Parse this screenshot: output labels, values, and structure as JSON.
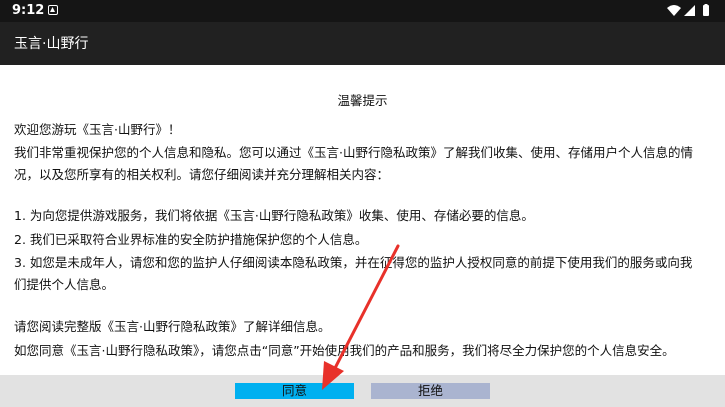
{
  "status_bar": {
    "time": "9:12",
    "icons": [
      "notification-icon",
      "wifi-icon",
      "signal-icon",
      "battery-icon"
    ]
  },
  "app_bar": {
    "title": "玉言·山野行"
  },
  "dialog": {
    "title": "温馨提示",
    "lines": [
      "欢迎您游玩《玉言·山野行》！",
      "我们非常重视保护您的个人信息和隐私。您可以通过《玉言·山野行隐私政策》了解我们收集、使用、存储用户个人信息的情",
      "况，以及您所享有的相关权利。请您仔细阅读并充分理解相关内容：",
      "1. 为向您提供游戏服务，我们将依据《玉言·山野行隐私政策》收集、使用、存储必要的信息。",
      "2. 我们已采取符合业界标准的安全防护措施保护您的个人信息。",
      "3. 如您是未成年人，请您和您的监护人仔细阅读本隐私政策，并在征得您的监护人授权同意的前提下使用我们的服务或向我",
      "们提供个人信息。",
      "请您阅读完整版《玉言·山野行隐私政策》了解详细信息。",
      "如您同意《玉言·山野行隐私政策》，请您点击“同意”开始使用我们的产品和服务，我们将尽全力保护您的个人信息安全。"
    ]
  },
  "buttons": {
    "agree": "同意",
    "refuse": "拒绝"
  },
  "colors": {
    "status_bar": "#151515",
    "app_bar": "#212121",
    "agree_button": "#00b0f0",
    "refuse_button": "#aab4d0",
    "footer": "#e2e2e2",
    "annotation_arrow": "#e8312a"
  }
}
